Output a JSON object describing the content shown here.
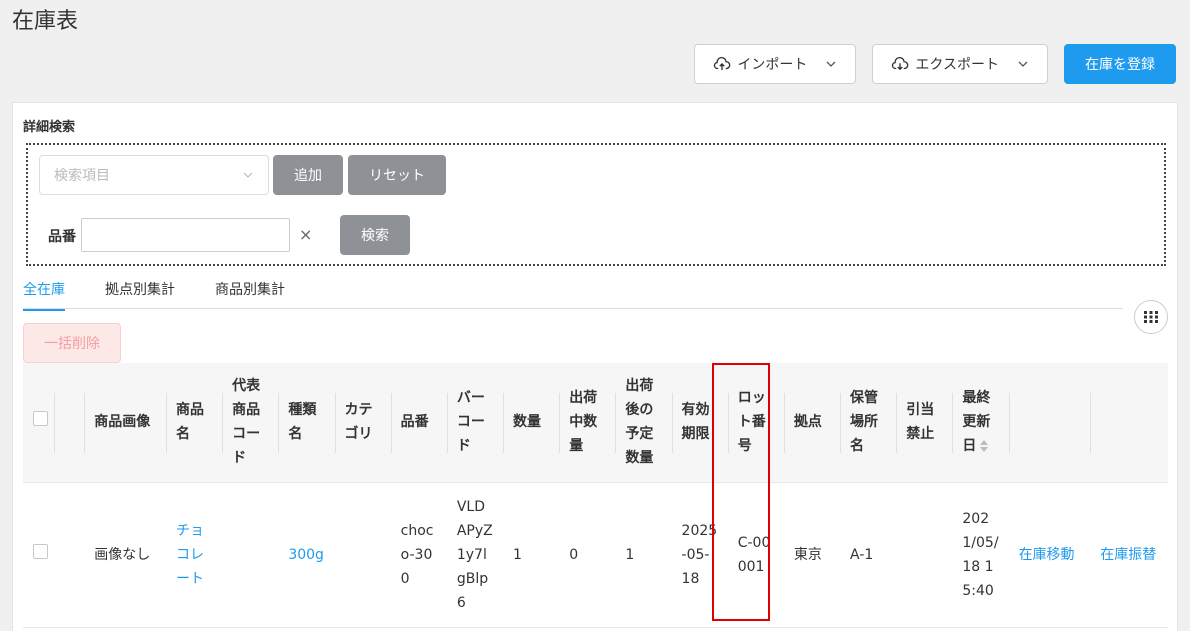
{
  "page": {
    "title": "在庫表"
  },
  "actions": {
    "import_label": "インポート",
    "export_label": "エクスポート",
    "register_label": "在庫を登録"
  },
  "search": {
    "section_label": "詳細検索",
    "select_placeholder": "検索項目",
    "add_label": "追加",
    "reset_label": "リセット",
    "field_label": "品番",
    "field_value": "",
    "clear_symbol": "×",
    "search_label": "検索"
  },
  "tabs": [
    "全在庫",
    "拠点別集計",
    "商品別集計"
  ],
  "bulk_delete_label": "一括削除",
  "table": {
    "headers": [
      "",
      "",
      "商品画像",
      "商品名",
      "代表商品コード",
      "種類名",
      "カテゴリ",
      "品番",
      "バーコード",
      "数量",
      "出荷中数量",
      "出荷後の予定数量",
      "有効期限",
      "ロット番号",
      "拠点",
      "保管場所名",
      "引当禁止",
      "最終更新日",
      "",
      "",
      ""
    ],
    "rows": [
      {
        "image": "画像なし",
        "product_name": "チョコレート",
        "rep_code": "",
        "variant": "300g",
        "category": "",
        "part_no": "choco-300",
        "barcode": "VLDAPyZ1y7lgBlp6",
        "qty": "1",
        "shipping_qty": "0",
        "planned_qty": "1",
        "expiry": "2025-05-18",
        "lot": "C-00001",
        "location": "東京",
        "storage": "A-1",
        "reserve_block": "",
        "updated": "2021/05/18 15:40",
        "move_label": "在庫移動",
        "transfer_label": "在庫振替"
      }
    ]
  },
  "colors": {
    "accent": "#1e9bef",
    "highlight": "#e00000",
    "danger_bg": "#fde8e8"
  }
}
